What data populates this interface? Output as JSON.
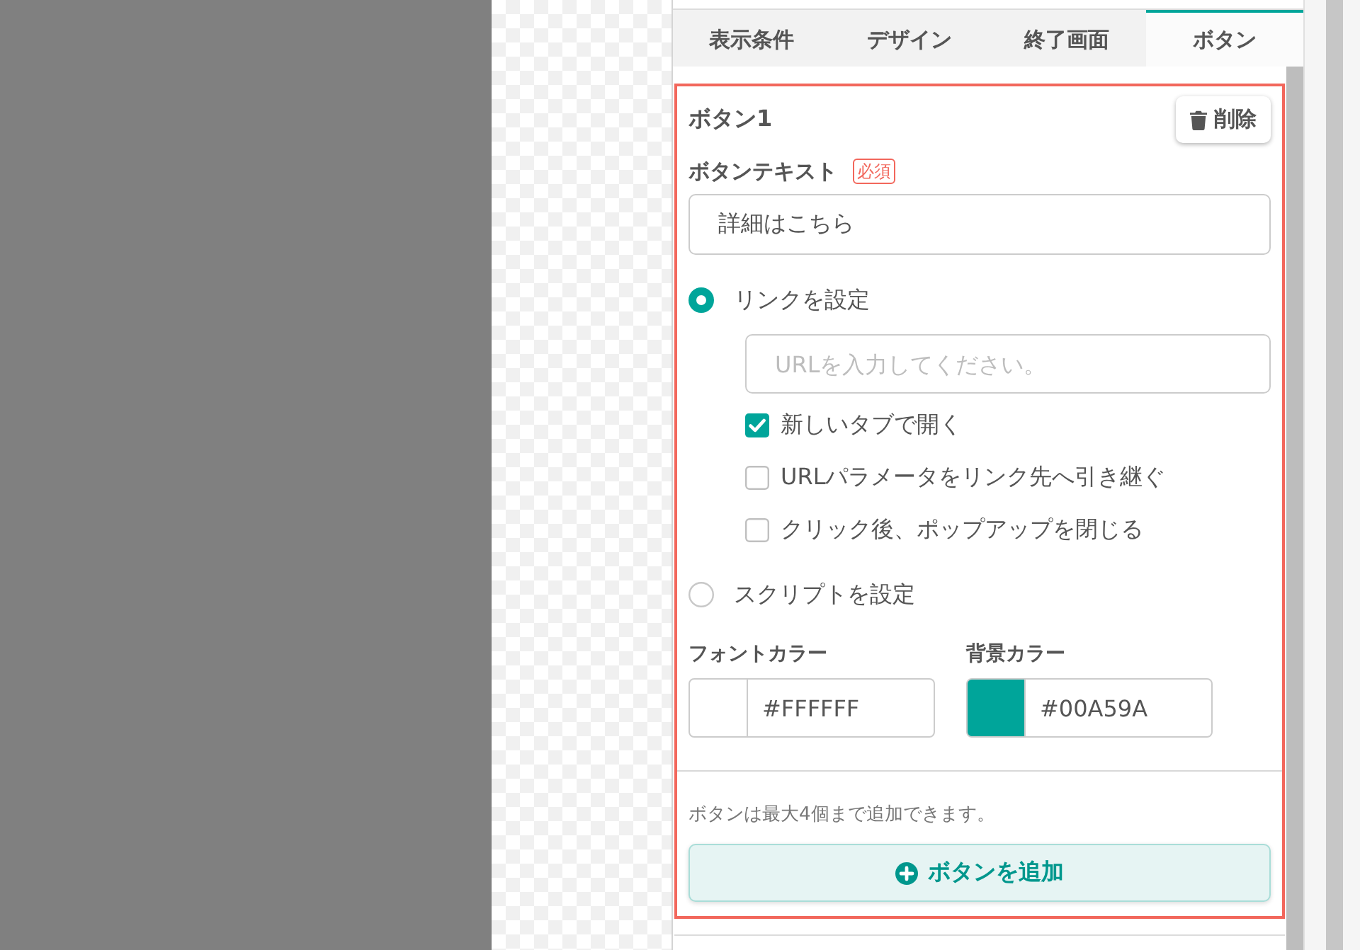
{
  "tabs": [
    {
      "label": "表示条件",
      "selected": false
    },
    {
      "label": "デザイン",
      "selected": false
    },
    {
      "label": "終了画面",
      "selected": false
    },
    {
      "label": "ボタン",
      "selected": true
    }
  ],
  "button_card": {
    "highlighted": true,
    "title": "ボタン1",
    "delete_button": "削除",
    "text_field": {
      "label": "ボタンテキスト",
      "required_badge": "必須",
      "value": "詳細はこちら"
    },
    "actions": [
      {
        "label": "リンクを設定",
        "selected": true,
        "url_field": {
          "placeholder": "URLを入力してください。"
        },
        "options": [
          {
            "label": "新しいタブで開く",
            "checked": true
          },
          {
            "label": "URLパラメータをリンク先へ引き継ぐ",
            "checked": false
          },
          {
            "label": "クリック後、ポップアップを閉じる",
            "checked": false
          }
        ]
      },
      {
        "label": "スクリプトを設定",
        "selected": false
      }
    ],
    "colors": [
      {
        "label": "フォントカラー",
        "value": "#FFFFFF",
        "color": "#ffffff"
      },
      {
        "label": "背景カラー",
        "value": "#00A59A",
        "color": "#00a59a"
      }
    ],
    "note": "ボタンは最大4個まで追加できます。",
    "add_button": "ボタンを追加"
  }
}
